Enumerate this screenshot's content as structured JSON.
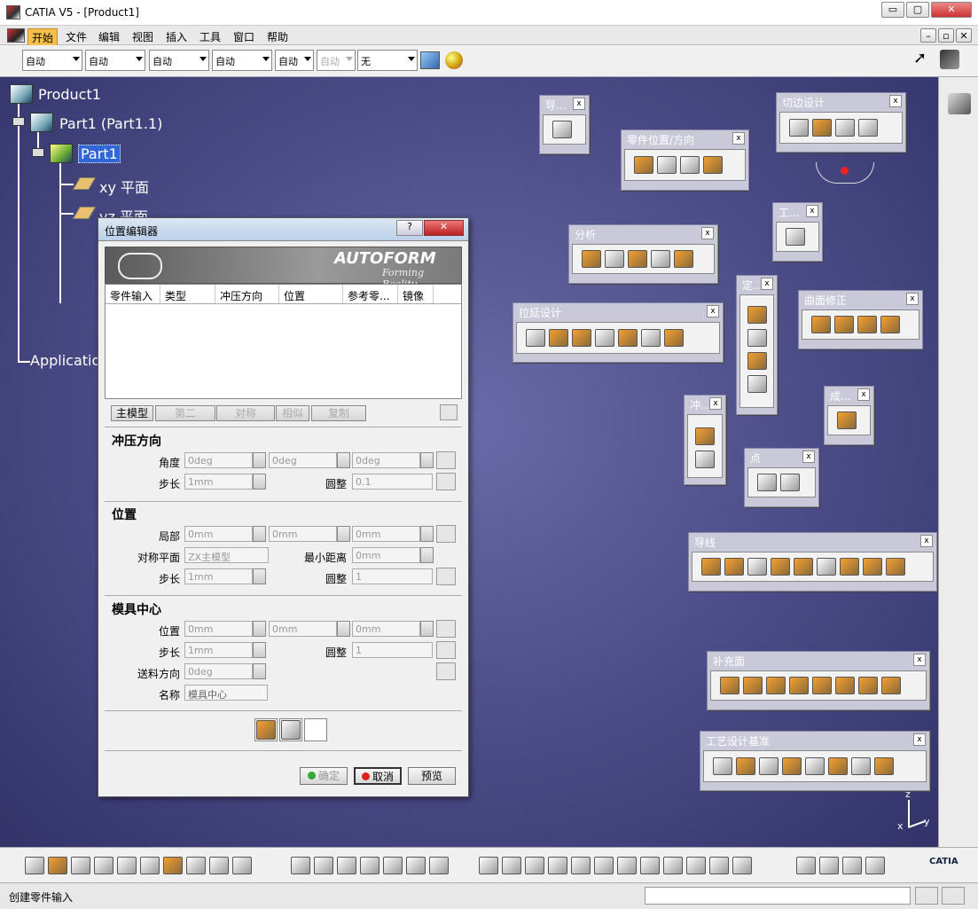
{
  "window": {
    "title": "CATIA V5 - [Product1]",
    "min": "▭",
    "max": "▢",
    "close": "✕",
    "mdi_min": "–",
    "mdi_restore": "▫",
    "mdi_close": "✕"
  },
  "menu": [
    "开始",
    "文件",
    "编辑",
    "视图",
    "插入",
    "工具",
    "窗口",
    "帮助"
  ],
  "toolbar": {
    "selects": [
      "自动",
      "自动",
      "自动",
      "自动",
      "自动",
      "自动",
      "无"
    ]
  },
  "tree": {
    "root": "Product1",
    "part_instance": "Part1 (Part1.1)",
    "part": "Part1",
    "planes": [
      "xy 平面",
      "yz 平面"
    ],
    "applications": "Application"
  },
  "palettes": {
    "guide_small": {
      "title": "导..."
    },
    "part_position": {
      "title": "零件位置/方向"
    },
    "edge_design": {
      "title": "切边设计"
    },
    "tool": {
      "title": "工..."
    },
    "analysis": {
      "title": "分析"
    },
    "define": {
      "title": "定..."
    },
    "surface_fix": {
      "title": "曲面修正"
    },
    "stretch_design": {
      "title": "拉延设计"
    },
    "forming": {
      "title": "成..."
    },
    "punch": {
      "title": "冲..."
    },
    "point": {
      "title": "点"
    },
    "guideline": {
      "title": "导线"
    },
    "addendum": {
      "title": "补充面"
    },
    "process_datum": {
      "title": "工艺设计基准"
    },
    "close_x": "x"
  },
  "dialog": {
    "title": "位置编辑器",
    "help": "?",
    "close": "✕",
    "brand": "AUTOFORM",
    "brand_sub": "Forming Reality",
    "columns": [
      "零件输入",
      "类型",
      "冲压方向",
      "位置",
      "参考零...",
      "镜像"
    ],
    "tabs": [
      "主模型",
      "第二",
      "对称",
      "相似",
      "复制"
    ],
    "press_direction": {
      "title": "冲压方向",
      "angle_label": "角度",
      "angles": [
        "0deg",
        "0deg",
        "0deg"
      ],
      "step_label": "步长",
      "step": "1mm",
      "round_label": "圆整",
      "round": "0.1"
    },
    "position": {
      "title": "位置",
      "local_label": "局部",
      "locals": [
        "0mm",
        "0mm",
        "0mm"
      ],
      "sym_label": "对称平面",
      "sym": "ZX主模型",
      "min_label": "最小距离",
      "min": "0mm",
      "step_label": "步长",
      "step": "1mm",
      "round_label": "圆整",
      "round": "1"
    },
    "die_center": {
      "title": "模具中心",
      "pos_label": "位置",
      "pos": [
        "0mm",
        "0mm",
        "0mm"
      ],
      "step_label": "步长",
      "step": "1mm",
      "round_label": "圆整",
      "round": "1",
      "feed_label": "送料方向",
      "feed": "0deg",
      "name_label": "名称",
      "name": "模具中心"
    },
    "ok": "确定",
    "cancel": "取消",
    "preview": "预览"
  },
  "status": {
    "text": "创建零件输入"
  },
  "axis": {
    "x": "x",
    "y": "y",
    "z": "z"
  },
  "brand_logo": "CATIA",
  "colors": {
    "canvas": "#4a4a86",
    "accent": "#f5a030"
  }
}
